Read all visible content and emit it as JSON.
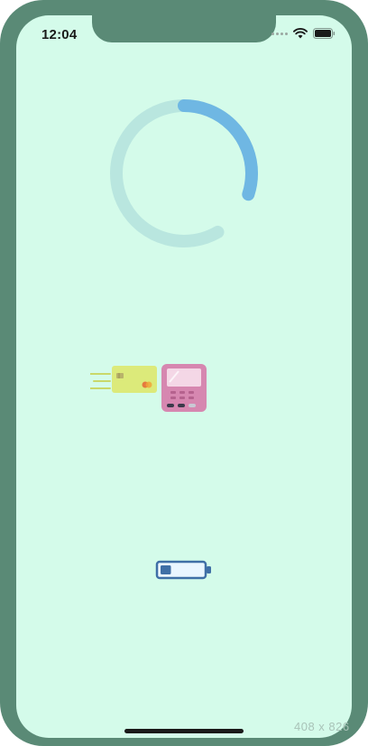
{
  "status_bar": {
    "time": "12:04",
    "icons": [
      "signal-dots-icon",
      "wifi-icon",
      "battery-full-icon"
    ]
  },
  "loading_ring": {
    "progress": 0.3,
    "track_color": "#b9e6df",
    "fill_color": "#6fb7e3"
  },
  "illustration": {
    "icons": [
      "credit-card-icon",
      "payment-terminal-icon"
    ],
    "card_color": "#dcea7a",
    "terminal_color": "#d687b0"
  },
  "battery_indicator": {
    "icon": "battery-low-icon",
    "level": 0.25,
    "color": "#3f6fa6"
  },
  "watermark": {
    "text": "408 x 826"
  },
  "colors": {
    "device_frame": "#5a8a76",
    "screen_background": "#d4fbea"
  }
}
